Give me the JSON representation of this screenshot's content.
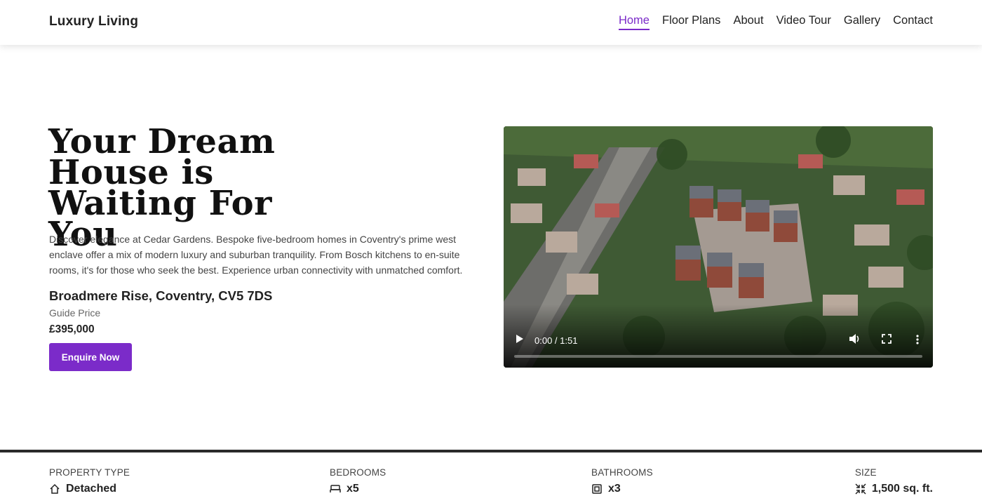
{
  "navbar": {
    "brand": "Luxury Living",
    "links": [
      {
        "label": "Home",
        "active": true
      },
      {
        "label": "Floor Plans"
      },
      {
        "label": "About"
      },
      {
        "label": "Video Tour"
      },
      {
        "label": "Gallery"
      },
      {
        "label": "Contact"
      }
    ],
    "accent_color": "#7b2bc9"
  },
  "hero": {
    "title": "Your Dream House is Waiting For You",
    "description": "Discover elegance at Cedar Gardens. Bespoke five-bedroom homes in Coventry's prime west enclave offer a mix of modern luxury and suburban tranquility. From Bosch kitchens to en-suite rooms, it's for those who seek the best. Experience urban connectivity with unmatched comfort.",
    "address": "Broadmere Rise, Coventry, CV5 7DS",
    "guide_price_label": "Guide Price",
    "price": "£395,000",
    "cta_label": "Enquire Now"
  },
  "video": {
    "time_display": "0:00 / 1:51",
    "progress": 0,
    "controls": [
      "play-icon",
      "volume-icon",
      "fullscreen-icon",
      "more-options-icon"
    ]
  },
  "features": [
    {
      "label": "PROPERTY TYPE",
      "value": "Detached",
      "icon": "house-icon"
    },
    {
      "label": "BEDROOMS",
      "value": "x5",
      "icon": "bed-icon"
    },
    {
      "label": "BATHROOMS",
      "value": "x3",
      "icon": "bath-icon"
    },
    {
      "label": "SIZE",
      "value": "1,500 sq. ft.",
      "icon": "size-icon"
    }
  ]
}
